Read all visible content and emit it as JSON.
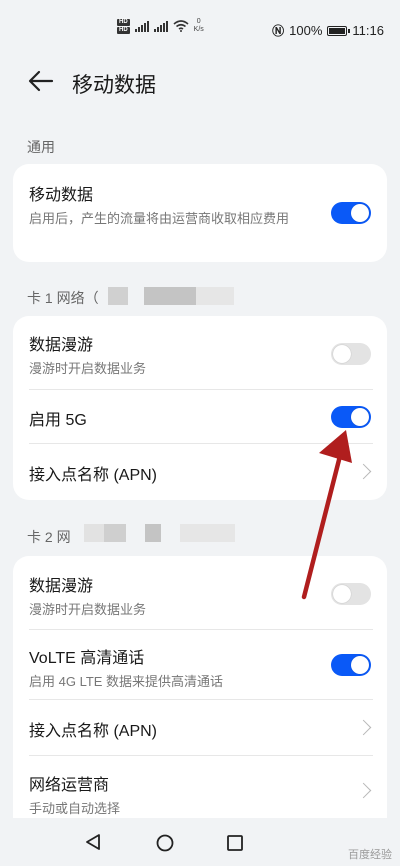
{
  "status": {
    "speed_value": "0",
    "speed_unit": "K/s",
    "battery": "100%",
    "time": "11:16",
    "sim1": "HD",
    "sim2": "HD"
  },
  "header": {
    "title": "移动数据"
  },
  "general": {
    "section_label": "通用",
    "mobile_data": {
      "title": "移动数据",
      "subtitle": "启用后，产生的流量将由运营商收取相应费用",
      "enabled": true
    }
  },
  "sim1": {
    "section_label": "卡 1 网络（",
    "roaming": {
      "title": "数据漫游",
      "subtitle": "漫游时开启数据业务",
      "enabled": false
    },
    "enable_5g": {
      "title": "启用 5G",
      "enabled": true
    },
    "apn": {
      "title": "接入点名称 (APN)"
    }
  },
  "sim2": {
    "section_label": "卡 2 网",
    "roaming": {
      "title": "数据漫游",
      "subtitle": "漫游时开启数据业务",
      "enabled": false
    },
    "volte": {
      "title": "VoLTE 高清通话",
      "subtitle": "启用 4G LTE 数据来提供高清通话",
      "enabled": true
    },
    "apn": {
      "title": "接入点名称 (APN)"
    },
    "operator": {
      "title": "网络运营商",
      "subtitle": "手动或自动选择"
    }
  },
  "annotation_arrow_color": "#b01e1e",
  "accent_color": "#0a59f7",
  "watermark": "百度经验"
}
